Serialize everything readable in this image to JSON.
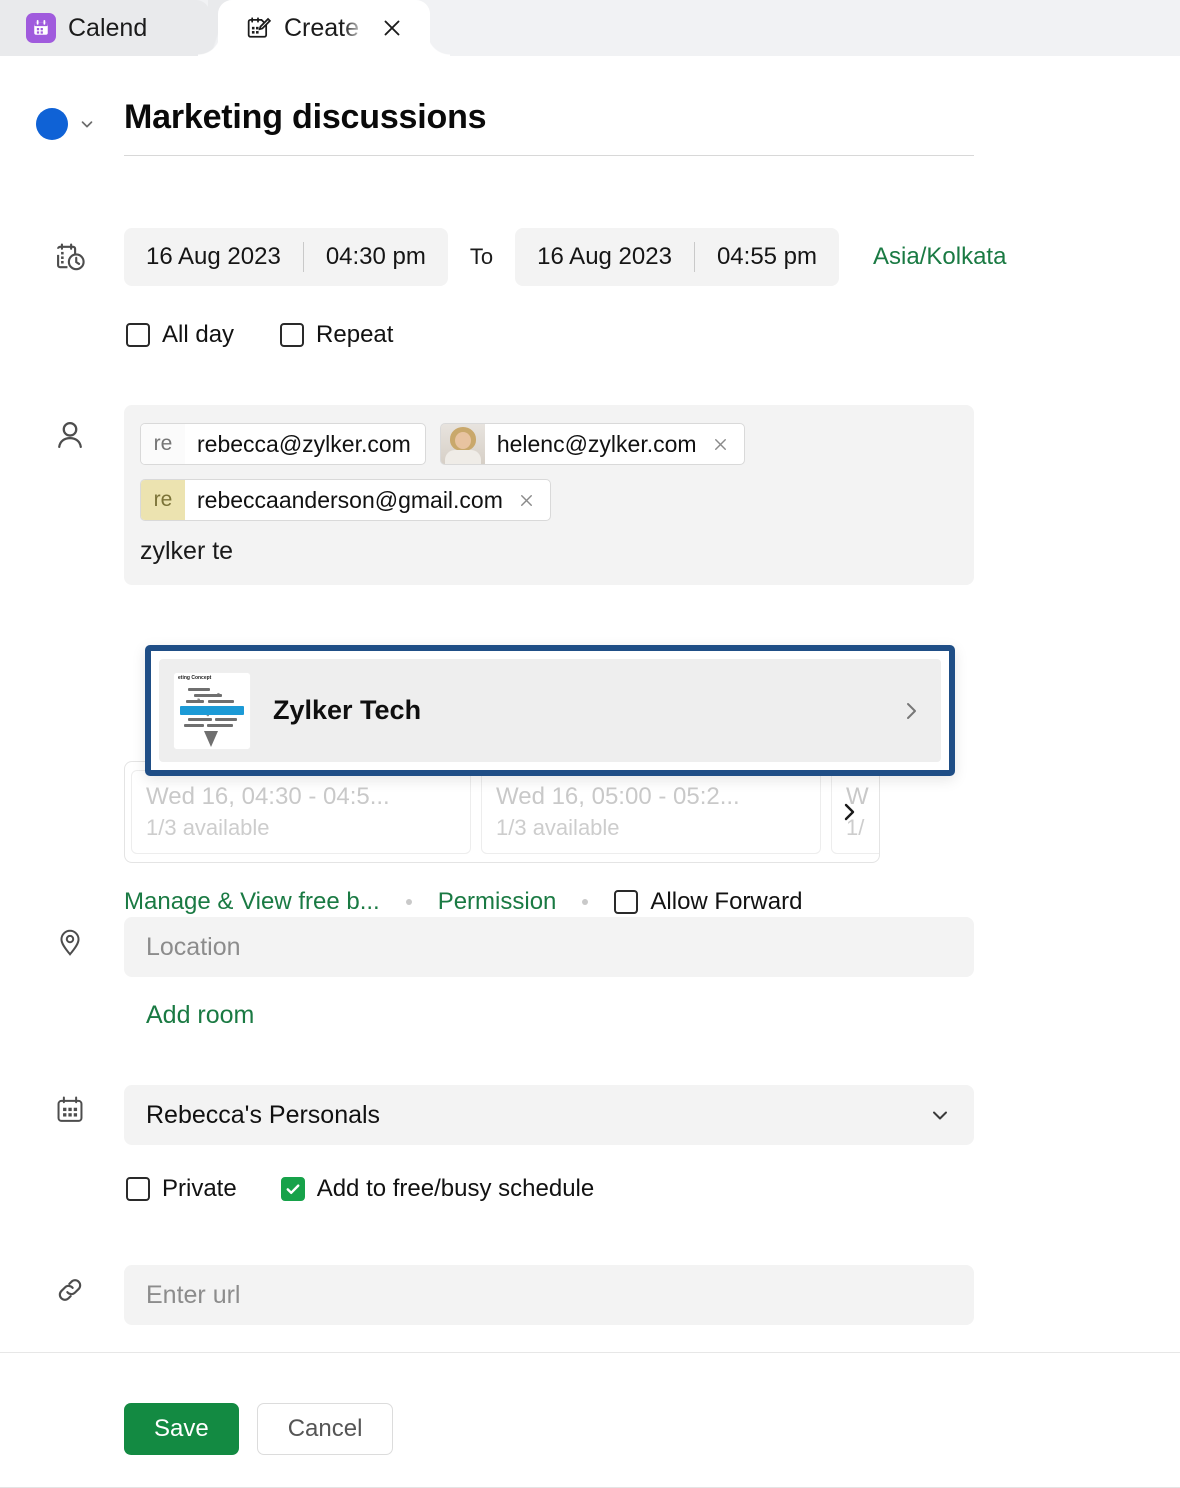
{
  "tabs": [
    {
      "label": "Calend",
      "icon": "calendar-app-icon",
      "active": false
    },
    {
      "label": "Create E",
      "icon": "create-event-icon",
      "active": true,
      "close_icon": "close-icon"
    }
  ],
  "event": {
    "color_swatch": "#0f62d6",
    "color_chevron_icon": "chevron-down-icon",
    "title": "Marketing discussions"
  },
  "datetime": {
    "icon": "date-time-icon",
    "start_date": "16 Aug 2023",
    "start_time": "04:30 pm",
    "to_label": "To",
    "end_date": "16 Aug 2023",
    "end_time": "04:55 pm",
    "timezone": "Asia/Kolkata",
    "all_day_label": "All day",
    "all_day_checked": false,
    "repeat_label": "Repeat",
    "repeat_checked": false
  },
  "attendees": {
    "icon": "person-icon",
    "chips": [
      {
        "avatar_type": "initials-grey",
        "initials": "re",
        "email": "rebecca@zylker.com",
        "removable": false
      },
      {
        "avatar_type": "photo",
        "initials": "",
        "email": "helenc@zylker.com",
        "removable": true,
        "remove_icon": "close-icon"
      },
      {
        "avatar_type": "initials-tan",
        "initials": "re",
        "email": "rebeccaanderson@gmail.com",
        "removable": true,
        "remove_icon": "close-icon"
      }
    ],
    "typed_text": "zylker te",
    "suggestions": [
      {
        "name": "Zylker Tech",
        "thumbnail": "marketing-wordcloud-image",
        "chevron_icon": "chevron-right-icon"
      }
    ]
  },
  "freebusy": {
    "slots": [
      {
        "range": "Wed 16, 04:30 - 04:5...",
        "availability": "1/3 available"
      },
      {
        "range": "Wed 16, 05:00 - 05:2...",
        "availability": "1/3 available"
      },
      {
        "range": "W",
        "availability": "1/"
      }
    ],
    "next_icon": "chevron-right-icon",
    "manage_link": "Manage & View free b...",
    "permission_link": "Permission",
    "allow_forward_label": "Allow Forward",
    "allow_forward_checked": false
  },
  "location": {
    "icon": "location-pin-icon",
    "placeholder": "Location",
    "value": "",
    "add_room_link": "Add room"
  },
  "calendar": {
    "icon": "calendar-icon",
    "selected": "Rebecca's Personals",
    "chevron_icon": "chevron-down-icon",
    "private_label": "Private",
    "private_checked": false,
    "freebusy_label": "Add to free/busy schedule",
    "freebusy_checked": true
  },
  "url": {
    "icon": "link-icon",
    "placeholder": "Enter url",
    "value": ""
  },
  "footer": {
    "save_label": "Save",
    "cancel_label": "Cancel"
  },
  "colors": {
    "green": "#1a7a43",
    "save_green": "#138a42",
    "checkbox_green": "#17a24a",
    "event_blue": "#0f62d6",
    "dropdown_border": "#1f4e86",
    "tab_purple": "#a05bdd"
  }
}
